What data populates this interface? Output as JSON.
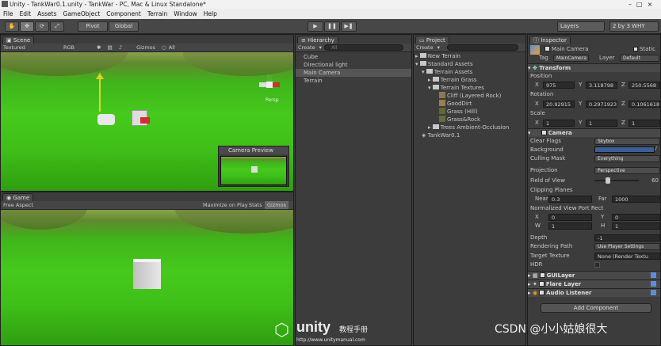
{
  "titlebar": {
    "title": "Unity - TankWar0.1.unity - TankWar - PC, Mac & Linux Standalone*"
  },
  "menu": [
    "File",
    "Edit",
    "Assets",
    "GameObject",
    "Component",
    "Terrain",
    "Window",
    "Help"
  ],
  "toolbar": {
    "pivot": "Pivot",
    "global": "Global",
    "layers": "Layers",
    "layout": "2 by 3 WHY"
  },
  "scene": {
    "tab": "Scene",
    "shading": "Textured",
    "rgb": "RGB",
    "gizmos": "Gizmos",
    "search": "All",
    "gizmo_label": "Persp",
    "camera_preview": "Camera Preview"
  },
  "game": {
    "tab": "Game",
    "aspect": "Free Aspect",
    "maximize": "Maximize on Play",
    "stats": "Stats",
    "gizmos": "Gizmos"
  },
  "hierarchy": {
    "tab": "Hierarchy",
    "create": "Create",
    "search": "All",
    "items": [
      "Cube",
      "Directional light",
      "Main Camera",
      "Terrain"
    ]
  },
  "project": {
    "tab": "Project",
    "create": "Create",
    "items": [
      "New Terrain",
      "Standard Assets",
      "Terrain Assets",
      "Terrain Grass",
      "Terrain Textures",
      "Cliff (Layered Rock)",
      "GoodDirt",
      "Grass (Hill)",
      "Grass&Rock",
      "Trees Ambient-Occlusion",
      "TankWar0.1"
    ]
  },
  "inspector": {
    "tab": "Inspector",
    "object": "Main Camera",
    "static": "Static",
    "tag_label": "Tag",
    "tag": "MainCamera",
    "layer_label": "Layer",
    "layer": "Default",
    "transform": {
      "title": "Transform",
      "position": "Position",
      "rotation": "Rotation",
      "scale": "Scale",
      "x": "X",
      "y": "Y",
      "z": "Z",
      "pos": [
        "975",
        "3.118798",
        "250.5568"
      ],
      "rot": [
        "20.92915",
        "0.2971923",
        "0.1061618"
      ],
      "scl": [
        "1",
        "1",
        "1"
      ]
    },
    "camera": {
      "title": "Camera",
      "clear_flags": "Clear Flags",
      "clear_flags_v": "Skybox",
      "background": "Background",
      "culling": "Culling Mask",
      "culling_v": "Everything",
      "projection": "Projection",
      "projection_v": "Perspective",
      "fov": "Field of View",
      "fov_v": "60",
      "clipping": "Clipping Planes",
      "near": "Near",
      "near_v": "0.3",
      "far": "Far",
      "far_v": "1000",
      "viewport": "Normalized View Port Rect",
      "vx": "X",
      "vx_v": "0",
      "vy": "Y",
      "vy_v": "0",
      "vw": "W",
      "vw_v": "1",
      "vh": "H",
      "vh_v": "1",
      "depth": "Depth",
      "depth_v": "-1",
      "rendering": "Rendering Path",
      "rendering_v": "Use Player Settings",
      "target": "Target Texture",
      "target_v": "None (Render Textu",
      "hdr": "HDR"
    },
    "components": [
      "GUILayer",
      "Flare Layer",
      "Audio Listener"
    ],
    "add": "Add Component"
  },
  "watermark": {
    "brand": "unity",
    "sub": "教程手册",
    "url": "http://www.unitymanual.com",
    "csdn": "CSDN @小小姑娘很大"
  },
  "colors": {
    "accent": "#3e5f96",
    "bg": "#3a3a3a"
  }
}
